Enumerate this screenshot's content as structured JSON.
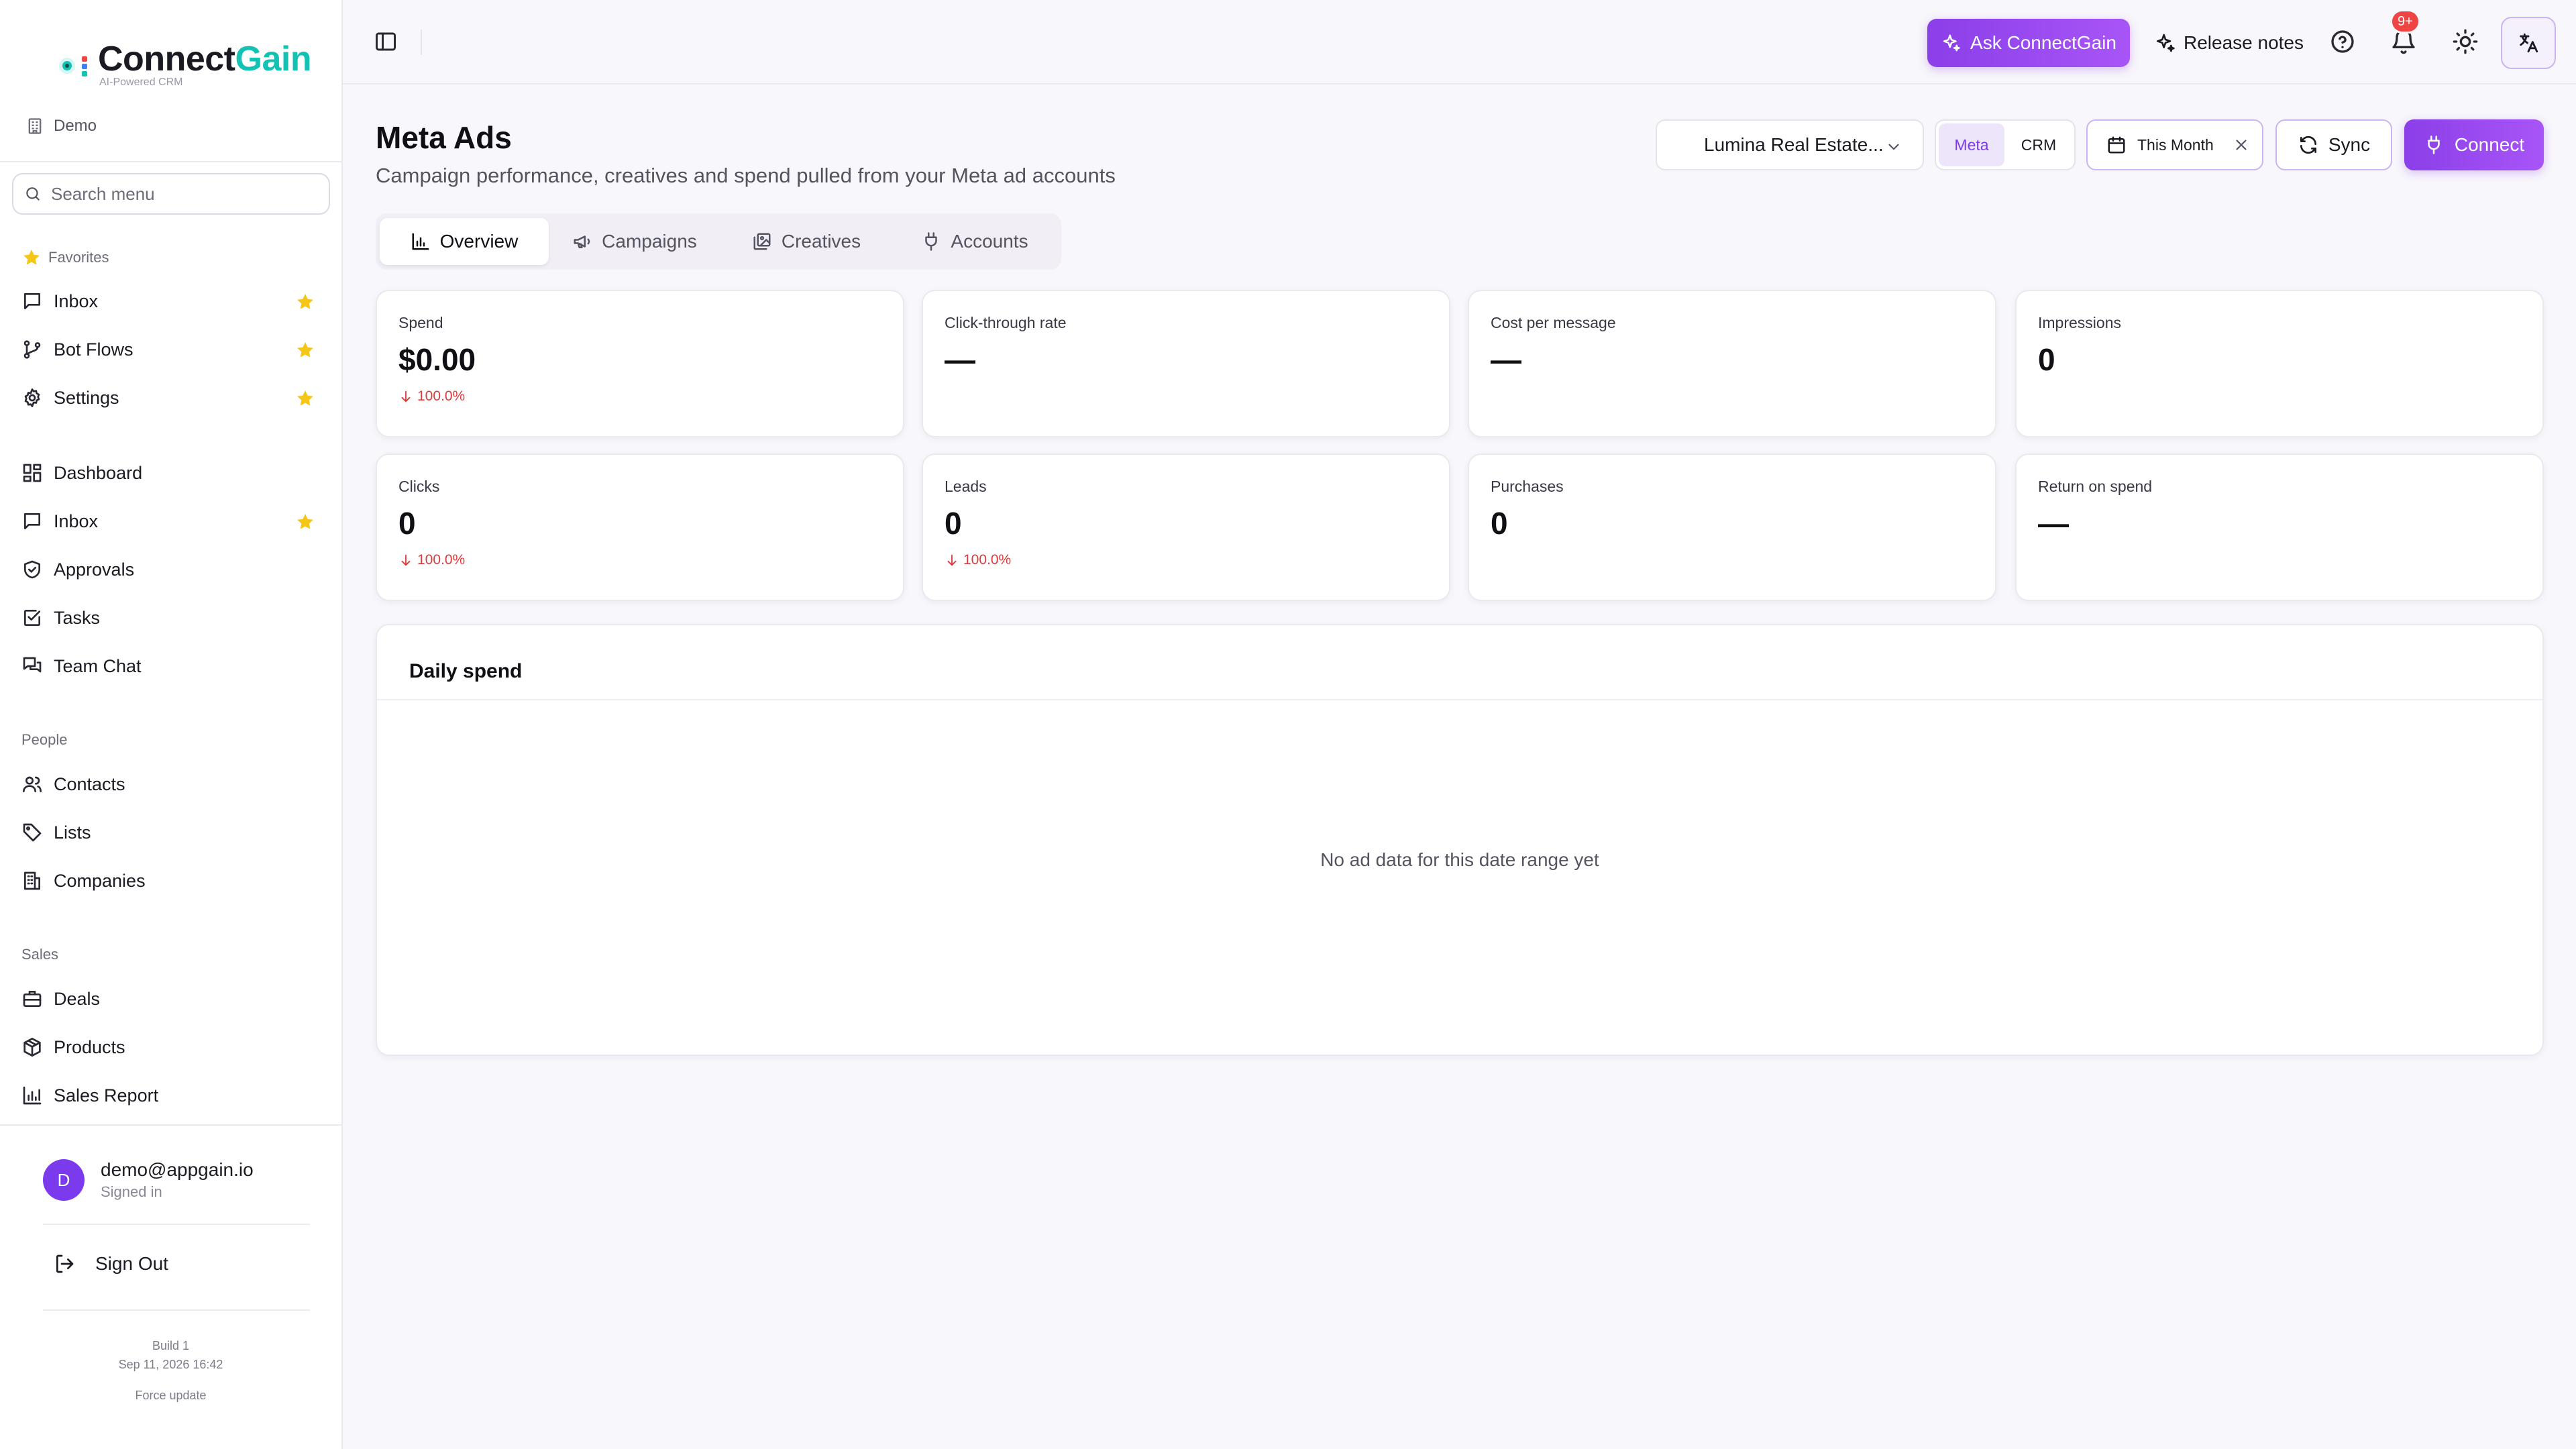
{
  "brand": {
    "name_part1": "Connect",
    "name_part2": "Gain",
    "tagline": "AI-Powered CRM",
    "accent": "#14c2b4"
  },
  "workspace": {
    "label": "Demo"
  },
  "search": {
    "placeholder": "Search menu"
  },
  "sidebar": {
    "favorites_label": "Favorites",
    "favorites": [
      {
        "label": "Inbox",
        "icon": "message-square-icon",
        "starred": true
      },
      {
        "label": "Bot Flows",
        "icon": "git-branch-icon",
        "starred": true
      },
      {
        "label": "Settings",
        "icon": "gear-icon",
        "starred": true
      }
    ],
    "main": [
      {
        "label": "Dashboard",
        "icon": "layout-dashboard-icon",
        "starred": false
      },
      {
        "label": "Inbox",
        "icon": "message-square-icon",
        "starred": true
      },
      {
        "label": "Approvals",
        "icon": "shield-check-icon",
        "starred": false
      },
      {
        "label": "Tasks",
        "icon": "check-square-icon",
        "starred": false
      },
      {
        "label": "Team Chat",
        "icon": "messages-icon",
        "starred": false
      }
    ],
    "people_label": "People",
    "people": [
      {
        "label": "Contacts",
        "icon": "users-icon"
      },
      {
        "label": "Lists",
        "icon": "tag-icon"
      },
      {
        "label": "Companies",
        "icon": "building-icon"
      }
    ],
    "sales_label": "Sales",
    "sales": [
      {
        "label": "Deals",
        "icon": "briefcase-icon"
      },
      {
        "label": "Products",
        "icon": "package-icon"
      },
      {
        "label": "Sales Report",
        "icon": "bar-chart-icon"
      }
    ]
  },
  "user": {
    "initial": "D",
    "email": "demo@appgain.io",
    "status": "Signed in"
  },
  "signout_label": "Sign Out",
  "build": {
    "line1": "Build 1",
    "line2": "Sep 11, 2026 16:42",
    "force_update": "Force update"
  },
  "topbar": {
    "ask_label": "Ask ConnectGain",
    "release_label": "Release notes",
    "notifications_badge": "9+"
  },
  "page": {
    "title": "Meta Ads",
    "subtitle": "Campaign performance, creatives and spend pulled from your Meta ad accounts"
  },
  "filters": {
    "account": "Lumina Real Estate...",
    "source_options": [
      "Meta",
      "CRM"
    ],
    "source_selected": "Meta",
    "date_range": "This Month",
    "sync_label": "Sync",
    "connect_label": "Connect"
  },
  "tabs": [
    {
      "label": "Overview",
      "icon": "bar-chart-icon",
      "active": true
    },
    {
      "label": "Campaigns",
      "icon": "megaphone-icon",
      "active": false
    },
    {
      "label": "Creatives",
      "icon": "images-icon",
      "active": false
    },
    {
      "label": "Accounts",
      "icon": "plug-icon",
      "active": false
    }
  ],
  "metrics": [
    {
      "label": "Spend",
      "value": "$0.00",
      "delta": "100.0%"
    },
    {
      "label": "Click-through rate",
      "value": "—",
      "delta": ""
    },
    {
      "label": "Cost per message",
      "value": "—",
      "delta": ""
    },
    {
      "label": "Impressions",
      "value": "0",
      "delta": ""
    },
    {
      "label": "Clicks",
      "value": "0",
      "delta": "100.0%"
    },
    {
      "label": "Leads",
      "value": "0",
      "delta": "100.0%"
    },
    {
      "label": "Purchases",
      "value": "0",
      "delta": ""
    },
    {
      "label": "Return on spend",
      "value": "—",
      "delta": ""
    }
  ],
  "daily_spend": {
    "title": "Daily spend",
    "empty_message": "No ad data for this date range yet"
  },
  "colors": {
    "primary": "#8b3fe8",
    "danger": "#dc3b3b",
    "star": "#f5c518"
  }
}
